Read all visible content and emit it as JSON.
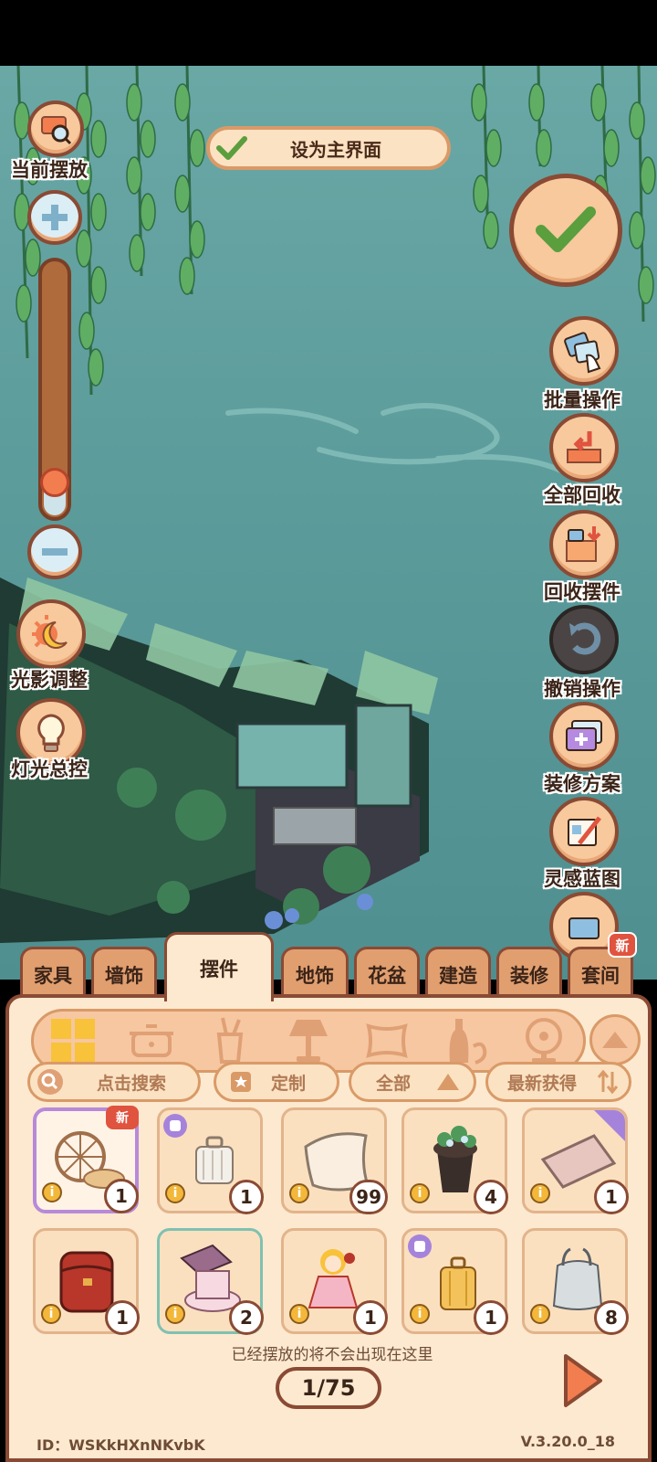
{
  "top_button": {
    "label": "设为主界面"
  },
  "left_tools": {
    "current_placement": "当前摆放",
    "lighting": "光影调整",
    "lamp_control": "灯光总控"
  },
  "zoom": {
    "level_fraction": 0.15
  },
  "right_tools": {
    "batch": "批量操作",
    "recycle_all": "全部回收",
    "recycle_items": "回收摆件",
    "undo": "撤销操作",
    "plans": "装修方案",
    "blueprint": "灵感蓝图"
  },
  "tabs": [
    "家具",
    "墙饰",
    "摆件",
    "地饰",
    "花盆",
    "建造",
    "装修",
    "套间"
  ],
  "active_tab": "摆件",
  "tab_badge": "新",
  "categories": [
    "all-icon",
    "pot-icon",
    "cup-icon",
    "lamp-icon",
    "pillow-icon",
    "bottle-icon",
    "fan-icon"
  ],
  "filters": {
    "search_placeholder": "点击搜索",
    "custom": "定制",
    "all": "全部",
    "sort": "最新获得"
  },
  "items": [
    {
      "name": "spinning-wheel",
      "count": "1",
      "badge": "新"
    },
    {
      "name": "suitcase-white",
      "count": "1"
    },
    {
      "name": "cushion-cream",
      "count": "99"
    },
    {
      "name": "plant-stand",
      "count": "4"
    },
    {
      "name": "pillow-pink",
      "count": "1"
    },
    {
      "name": "red-backpack",
      "count": "1"
    },
    {
      "name": "makeup-box",
      "count": "2"
    },
    {
      "name": "doll",
      "count": "1"
    },
    {
      "name": "suitcase-yellow",
      "count": "1"
    },
    {
      "name": "plastic-bag",
      "count": "8"
    }
  ],
  "item_info_glyph": "i",
  "note": "已经摆放的将不会出现在这里",
  "pager": "1/75",
  "footer": {
    "id": "ID：WSKkHXnNKvbK",
    "version": "V.3.20.0_18"
  }
}
